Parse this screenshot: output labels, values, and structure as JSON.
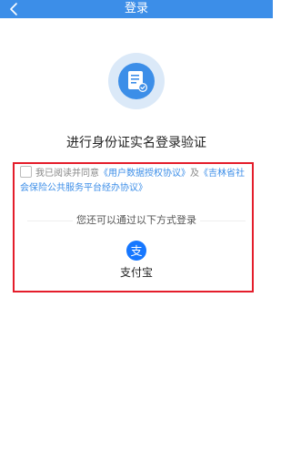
{
  "header": {
    "title": "登录",
    "back_icon": "chevron-left-icon"
  },
  "hero": {
    "icon": "id-document-verified-icon",
    "heading": "进行身份证实名登录验证"
  },
  "agreement": {
    "prefix": "我已阅读并同意",
    "link1": "《用户数据授权协议》",
    "middle": "及",
    "link2": "《吉林省社会保险公共服务平台经办协议》"
  },
  "alt_login": {
    "prompt": "您还可以通过以下方式登录",
    "alipay_label": "支付宝",
    "alipay_icon": "alipay-icon"
  },
  "colors": {
    "header_bg": "#3c8ee8",
    "link": "#3c8ee8",
    "highlight_border": "#e41d2b",
    "alipay_blue": "#1677ff"
  }
}
